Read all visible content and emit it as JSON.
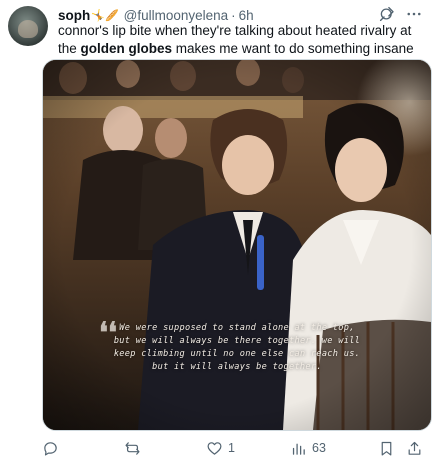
{
  "tweet": {
    "display_name": "soph",
    "name_emoji": "🤸🥖",
    "handle": "@fullmoonyelena",
    "separator": "·",
    "time": "6h",
    "text_part1": "connor's lip bite when they're talking about heated rivalry at the ",
    "text_bold": "golden globes",
    "text_part2": " makes me want to do something insane",
    "media": {
      "caption_lines": [
        "We were supposed to stand alone at the top,",
        "but we will always be there together. we will",
        "keep climbing until no one else can reach us.",
        "but it will always be together."
      ],
      "quote_mark": "❛❛"
    },
    "actions": {
      "reply_count": "",
      "retweet_count": "",
      "like_count": "1",
      "views_count": "63"
    }
  },
  "icons": {
    "grok": "grok-icon",
    "more": "more-icon",
    "reply": "reply-icon",
    "retweet": "retweet-icon",
    "like": "heart-icon",
    "views": "views-icon",
    "bookmark": "bookmark-icon",
    "share": "share-icon"
  },
  "colors": {
    "text": "#0f1419",
    "secondary": "#536471",
    "border": "#cfd9de"
  }
}
